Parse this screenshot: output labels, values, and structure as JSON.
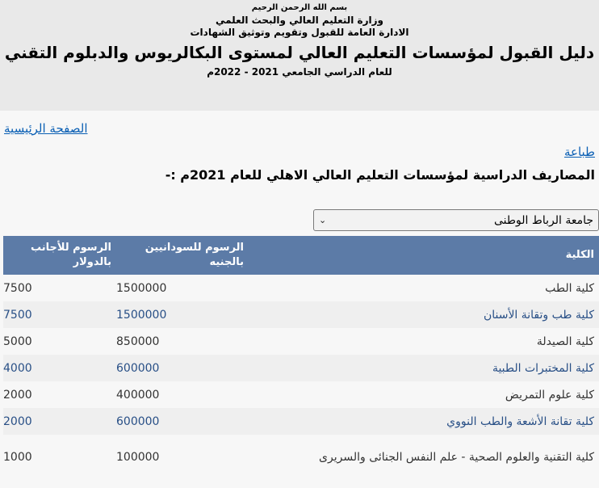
{
  "header": {
    "basmala": "بسم الله الرحمن الرحيم",
    "ministry": "وزارة التعليم العالي والبحث العلمي",
    "admin": "الادارة العامة للقبول وتقويم وتوثيق الشهادات",
    "main_title": "دليل القبول لمؤسسات التعليم العالي لمستوى البكالريوس والدبلوم التقني",
    "year": "للعام الدراسي الجامعي 2021 - 2022م"
  },
  "nav": {
    "home_label": "الصفحة الرئيسية",
    "print_label": "طباعة"
  },
  "page_heading": "المصاريف الدراسية لمؤسسات التعليم العالي الاهلي للعام 2021م :-",
  "university_select": {
    "selected": "جامعة الرباط الوطنى"
  },
  "table": {
    "headers": {
      "college": "الكلية",
      "fee_sudanese": "الرسوم للسودانيين بالجنيه",
      "fee_foreign": "الرسوم للأجانب بالدولار"
    },
    "rows": [
      {
        "college": "كلية الطب",
        "fee_sudanese": "1500000",
        "fee_foreign": "7500"
      },
      {
        "college": "كلية طب وتقانة الأسنان",
        "fee_sudanese": "1500000",
        "fee_foreign": "7500"
      },
      {
        "college": "كلية الصيدلة",
        "fee_sudanese": "850000",
        "fee_foreign": "5000"
      },
      {
        "college": "كلية المختبرات الطبية",
        "fee_sudanese": "600000",
        "fee_foreign": "4000"
      },
      {
        "college": "كلية علوم التمريض",
        "fee_sudanese": "400000",
        "fee_foreign": "2000"
      },
      {
        "college": "كلية تقانة الأشعة والطب النووي",
        "fee_sudanese": "600000",
        "fee_foreign": "2000"
      },
      {
        "college": "كلية التقنية والعلوم الصحية - علم النفس الجنائى والسريرى",
        "fee_sudanese": "100000",
        "fee_foreign": "1000"
      }
    ]
  }
}
